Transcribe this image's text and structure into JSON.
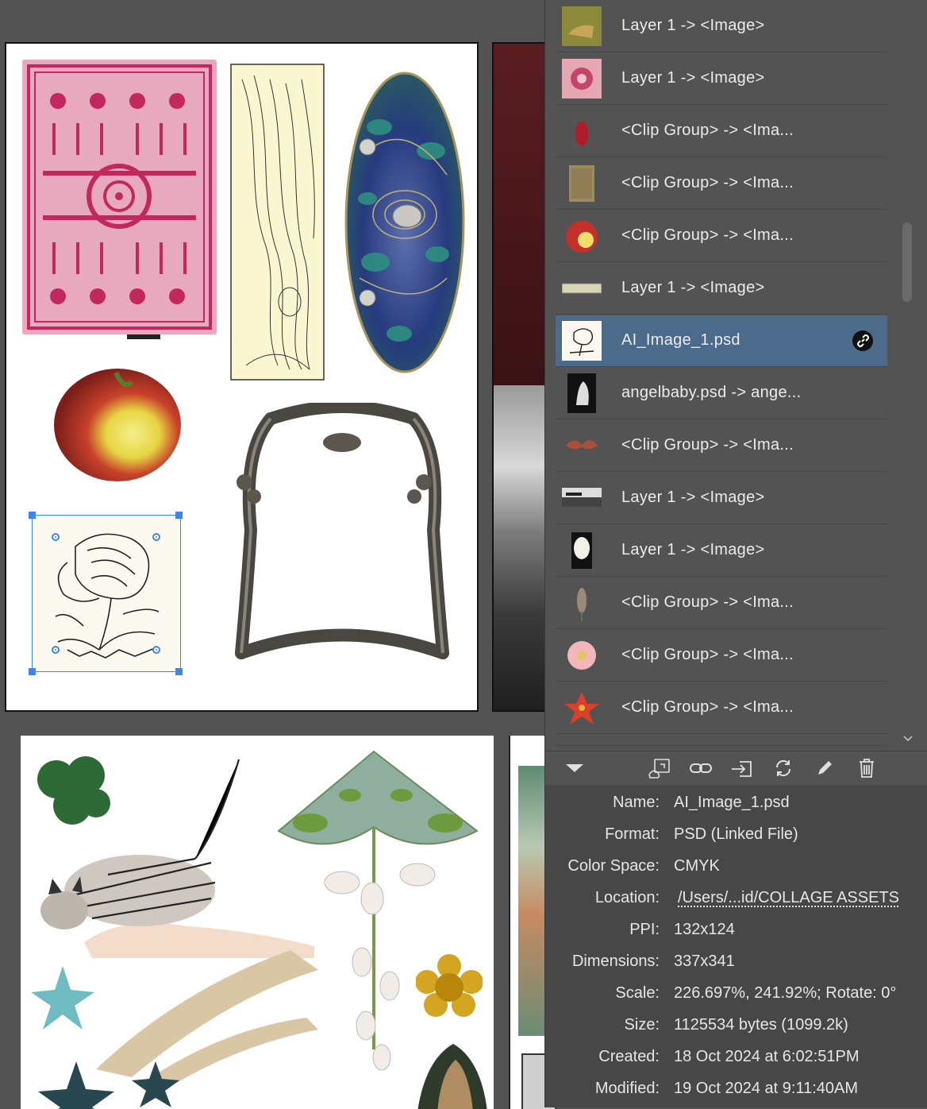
{
  "links_panel": {
    "rows": [
      {
        "label": "Layer 1 -> <Image>",
        "thumb": "deer-tapestry-thumb",
        "selected": false
      },
      {
        "label": "Layer 1 -> <Image>",
        "thumb": "pink-flower-thumb",
        "selected": false
      },
      {
        "label": "<Clip Group> -> <Ima...",
        "thumb": "red-berry-thumb",
        "selected": false
      },
      {
        "label": "<Clip Group> -> <Ima...",
        "thumb": "textured-paper-thumb",
        "selected": false
      },
      {
        "label": "<Clip Group> -> <Ima...",
        "thumb": "apple-thumb",
        "selected": false
      },
      {
        "label": "Layer 1 -> <Image>",
        "thumb": "strip-image-thumb",
        "selected": false
      },
      {
        "label": "AI_Image_1.psd",
        "thumb": "flower-sketch-thumb",
        "selected": true
      },
      {
        "label": "angelbaby.psd -> ange...",
        "thumb": "angel-statue-thumb",
        "selected": false
      },
      {
        "label": "<Clip Group> -> <Ima...",
        "thumb": "moth-thumb",
        "selected": false
      },
      {
        "label": "Layer 1 -> <Image>",
        "thumb": "seascape-thumb",
        "selected": false
      },
      {
        "label": "Layer 1 -> <Image>",
        "thumb": "ornament-thumb",
        "selected": false
      },
      {
        "label": "<Clip Group> -> <Ima...",
        "thumb": "lavender-thumb",
        "selected": false
      },
      {
        "label": "<Clip Group> -> <Ima...",
        "thumb": "pink-rose-thumb",
        "selected": false
      },
      {
        "label": "<Clip Group> -> <Ima...",
        "thumb": "red-lily-thumb",
        "selected": false
      }
    ],
    "toolbar": [
      "collapse-icon",
      "relink-from-cc-icon",
      "relink-icon",
      "go-to-link-icon",
      "update-link-icon",
      "edit-original-icon",
      "delete-icon"
    ],
    "info": {
      "name_key": "Name:",
      "name": "AI_Image_1.psd",
      "format_key": "Format:",
      "format": "PSD (Linked File)",
      "colorspace_key": "Color Space:",
      "colorspace": "CMYK",
      "location_key": "Location:",
      "location": "/Users/...id/COLLAGE ASSETS",
      "ppi_key": "PPI:",
      "ppi": "132x124",
      "dimensions_key": "Dimensions:",
      "dimensions": "337x341",
      "scale_key": "Scale:",
      "scale": "226.697%, 241.92%; Rotate: 0°",
      "size_key": "Size:",
      "size": "1125534 bytes (1099.2k)",
      "created_key": "Created:",
      "created": "18 Oct 2024 at 6:02:51PM",
      "modified_key": "Modified:",
      "modified": "19 Oct 2024 at 9:11:40AM"
    }
  },
  "colors": {
    "selection": "#3d84f5",
    "selected_row": "#4c6a89",
    "panel_bg": "#535353",
    "info_bg": "#474747"
  }
}
